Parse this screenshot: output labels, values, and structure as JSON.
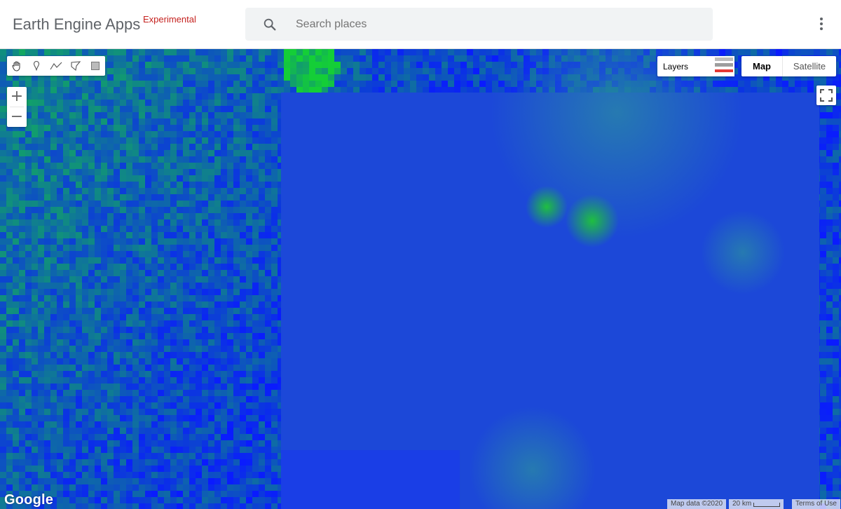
{
  "app": {
    "title": "Earth Engine Apps",
    "tag": "Experimental"
  },
  "search": {
    "placeholder": "Search places",
    "icon": "search-icon"
  },
  "menu": {
    "icon": "more-vert-icon"
  },
  "map": {
    "tools": [
      "hand-icon",
      "marker-icon",
      "polyline-icon",
      "polygon-icon",
      "rectangle-icon"
    ],
    "zoom_in": "+",
    "zoom_out": "−",
    "layers_label": "Layers",
    "map_type": {
      "map_label": "Map",
      "satellite_label": "Satellite",
      "selected": "Map"
    },
    "google_logo": "Google",
    "footer": {
      "map_data": "Map data ©2020",
      "scale": "20 km",
      "terms": "Terms of Use"
    }
  },
  "colors": {
    "low": "#0a1aff",
    "high": "#11c830",
    "accent_tag": "#c5221f"
  }
}
